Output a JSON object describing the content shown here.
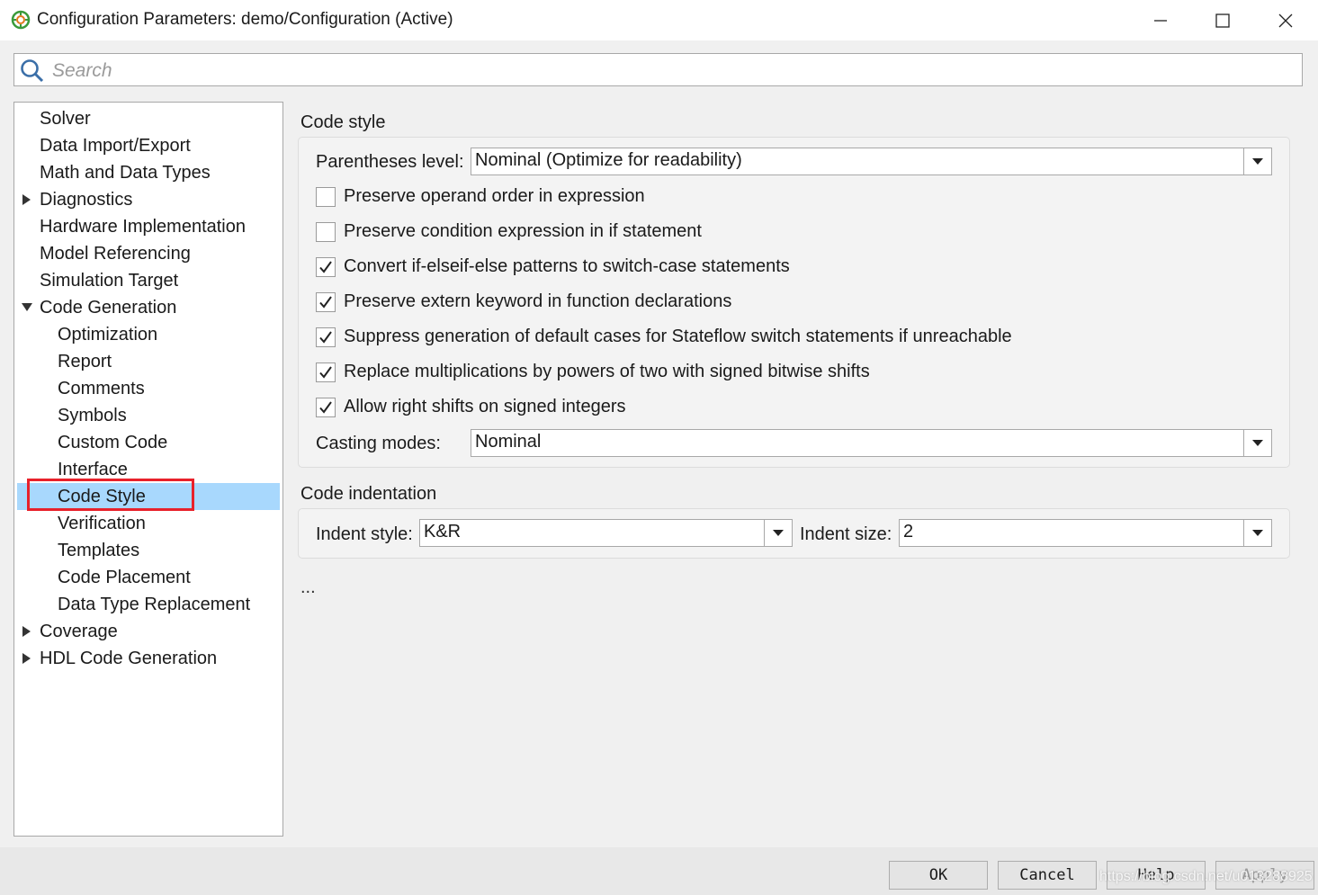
{
  "window": {
    "title": "Configuration Parameters: demo/Configuration (Active)"
  },
  "search": {
    "placeholder": "Search",
    "value": ""
  },
  "tree": {
    "items": [
      {
        "label": "Solver",
        "indent": 0,
        "arrow": ""
      },
      {
        "label": "Data Import/Export",
        "indent": 0,
        "arrow": ""
      },
      {
        "label": "Math and Data Types",
        "indent": 0,
        "arrow": ""
      },
      {
        "label": "Diagnostics",
        "indent": 0,
        "arrow": "collapsed"
      },
      {
        "label": "Hardware Implementation",
        "indent": 0,
        "arrow": ""
      },
      {
        "label": "Model Referencing",
        "indent": 0,
        "arrow": ""
      },
      {
        "label": "Simulation Target",
        "indent": 0,
        "arrow": ""
      },
      {
        "label": "Code Generation",
        "indent": 0,
        "arrow": "expanded"
      },
      {
        "label": "Optimization",
        "indent": 1,
        "arrow": ""
      },
      {
        "label": "Report",
        "indent": 1,
        "arrow": ""
      },
      {
        "label": "Comments",
        "indent": 1,
        "arrow": ""
      },
      {
        "label": "Symbols",
        "indent": 1,
        "arrow": ""
      },
      {
        "label": "Custom Code",
        "indent": 1,
        "arrow": ""
      },
      {
        "label": "Interface",
        "indent": 1,
        "arrow": ""
      },
      {
        "label": "Code Style",
        "indent": 1,
        "arrow": "",
        "selected": true
      },
      {
        "label": "Verification",
        "indent": 1,
        "arrow": ""
      },
      {
        "label": "Templates",
        "indent": 1,
        "arrow": ""
      },
      {
        "label": "Code Placement",
        "indent": 1,
        "arrow": ""
      },
      {
        "label": "Data Type Replacement",
        "indent": 1,
        "arrow": ""
      },
      {
        "label": "Coverage",
        "indent": 0,
        "arrow": "collapsed"
      },
      {
        "label": "HDL Code Generation",
        "indent": 0,
        "arrow": "collapsed"
      }
    ]
  },
  "code_style": {
    "title": "Code style",
    "parentheses_label": "Parentheses level:",
    "parentheses_value": "Nominal (Optimize for readability)",
    "checkboxes": [
      {
        "label": "Preserve operand order in expression",
        "checked": false
      },
      {
        "label": "Preserve condition expression in if statement",
        "checked": false
      },
      {
        "label": "Convert if-elseif-else patterns to switch-case statements",
        "checked": true
      },
      {
        "label": "Preserve extern keyword in function declarations",
        "checked": true
      },
      {
        "label": "Suppress generation of default cases for Stateflow switch statements if unreachable",
        "checked": true
      },
      {
        "label": "Replace multiplications by powers of two with signed bitwise shifts",
        "checked": true
      },
      {
        "label": "Allow right shifts on signed integers",
        "checked": true
      }
    ],
    "casting_label": "Casting modes:",
    "casting_value": "Nominal"
  },
  "code_indentation": {
    "title": "Code indentation",
    "style_label": "Indent style:",
    "style_value": "K&R",
    "size_label": "Indent size:",
    "size_value": "2"
  },
  "more": "...",
  "buttons": {
    "ok": "OK",
    "cancel": "Cancel",
    "help": "Help",
    "apply": "Apply"
  },
  "watermark": "https://blog.csdn.net/u013288925",
  "colors": {
    "selection": "#a8d8fd",
    "highlight_box": "#e8212b"
  }
}
